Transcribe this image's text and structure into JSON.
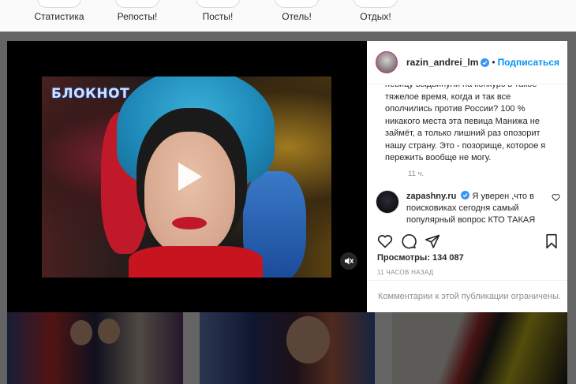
{
  "highlights": [
    {
      "label": "Статистика"
    },
    {
      "label": "Репосты!"
    },
    {
      "label": "Посты!"
    },
    {
      "label": "Отель!"
    },
    {
      "label": "Отдых!"
    }
  ],
  "video": {
    "logo_text": "БЛОКНОТ",
    "play_icon": "play-icon",
    "mute_icon": "volume-muted-icon"
  },
  "post": {
    "author": "razin_andrei_lm",
    "follow_label": "Подписаться",
    "caption": "певицу выдвинули на конкурс в такое тяжелое время, когда и так все ополчились против России? 100 % никакого места эта певица Манижа не займёт, а только лишний раз опозорит нашу страну. Это - позорище, которое я пережить вообще не могу.",
    "caption_time": "11 ч.",
    "comment": {
      "user": "zapashny.ru",
      "text": "Я уверен ,что в поисковиках сегодня самый популярный вопрос КТО ТАКАЯ"
    },
    "views_label": "Просмотры:",
    "views_count": "134 087",
    "time_ago": "11 ЧАСОВ НАЗАД",
    "comments_limited": "Комментарии к этой публикации ограничены."
  },
  "colors": {
    "accent": "#0095f6",
    "verified": "#3897f0",
    "muted_text": "#8e8e8e"
  }
}
